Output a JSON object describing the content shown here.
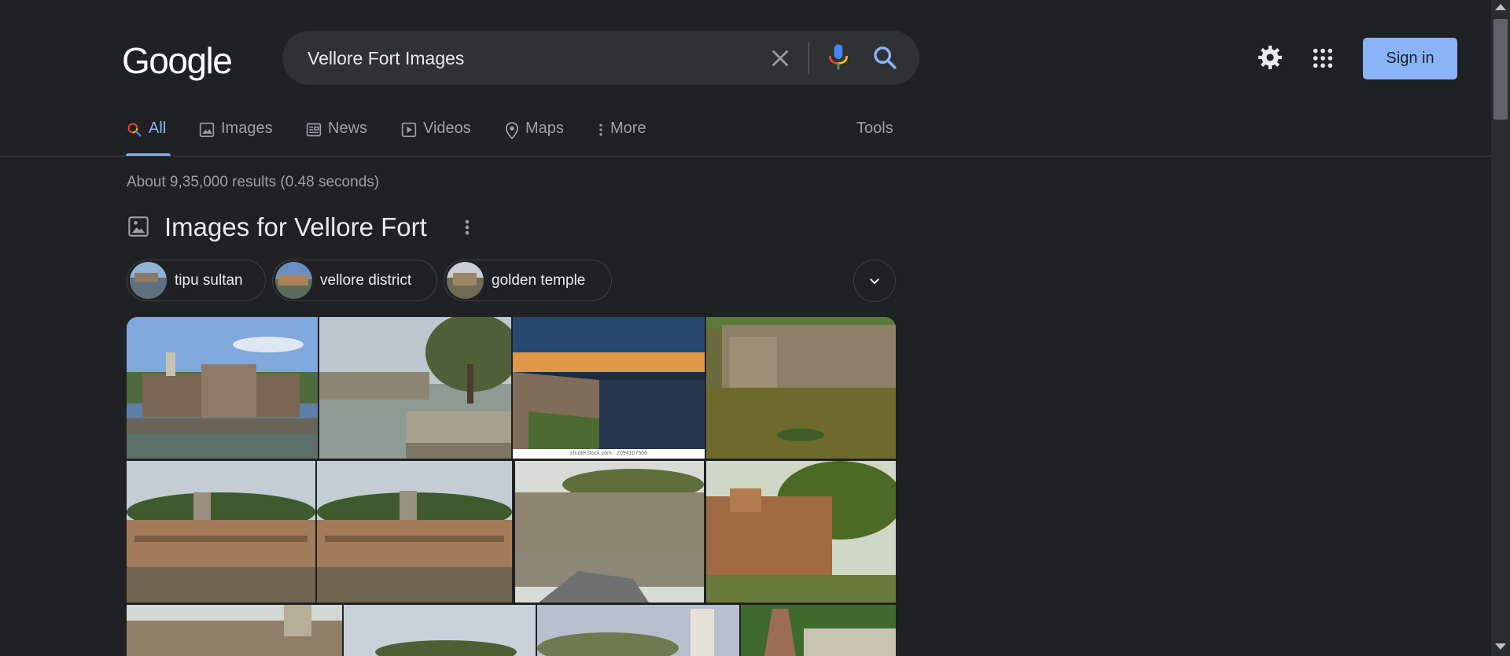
{
  "header": {
    "logo": "Google",
    "search_value": "Vellore Fort Images",
    "sign_in_label": "Sign in"
  },
  "tabs": [
    {
      "label": "All",
      "icon": "search-icon",
      "active": true
    },
    {
      "label": "Images",
      "icon": "image-icon"
    },
    {
      "label": "News",
      "icon": "news-icon"
    },
    {
      "label": "Videos",
      "icon": "video-icon"
    },
    {
      "label": "Maps",
      "icon": "map-pin-icon"
    },
    {
      "label": "More",
      "icon": "more-vert-icon"
    }
  ],
  "tools_label": "Tools",
  "result_stats": "About 9,35,000 results (0.48 seconds)",
  "images_section": {
    "title": "Images for Vellore Fort",
    "chips": [
      {
        "label": "tipu sultan"
      },
      {
        "label": "vellore district"
      },
      {
        "label": "golden temple"
      }
    ],
    "stock_watermark": "shutterstock.com · 2094107506"
  },
  "colors": {
    "background": "#202124",
    "accent": "#8ab4f8",
    "search_box": "#303134",
    "muted_text": "#9aa0a6"
  }
}
